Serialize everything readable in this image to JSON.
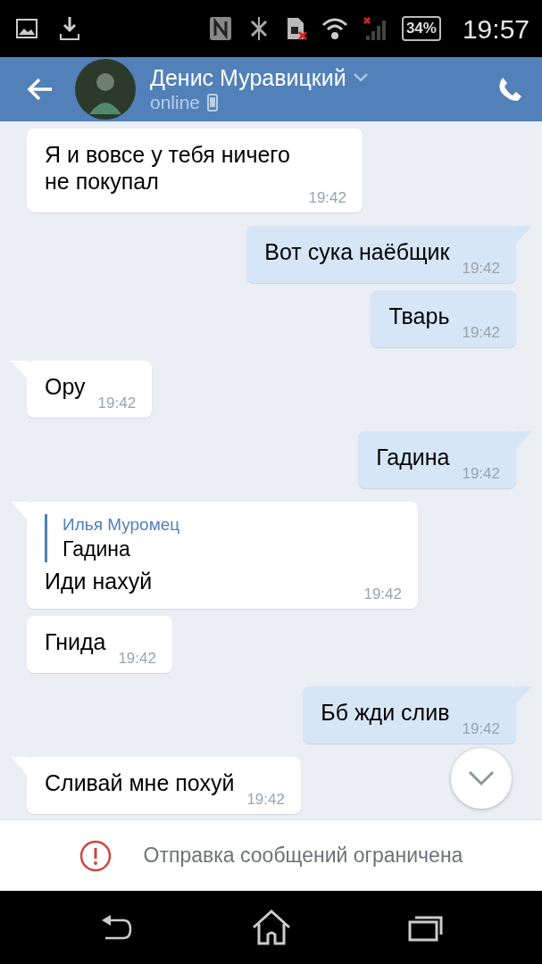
{
  "status_bar": {
    "battery": "34%",
    "time": "19:57"
  },
  "header": {
    "name": "Денис Муравицкий",
    "status": "online"
  },
  "messages": [
    {
      "outgoing": false,
      "tail": false,
      "text": "Я и вовсе у тебя ничего не покупал",
      "time": "19:42"
    },
    {
      "outgoing": true,
      "tail": true,
      "text": "Вот сука наёбщик",
      "time": "19:42"
    },
    {
      "outgoing": true,
      "tail": false,
      "text": "Тварь",
      "time": "19:42"
    },
    {
      "outgoing": false,
      "tail": true,
      "text": "Ору",
      "time": "19:42"
    },
    {
      "outgoing": true,
      "tail": true,
      "text": "Гадина",
      "time": "19:42"
    },
    {
      "outgoing": false,
      "tail": true,
      "reply": {
        "author": "Илья Муромец",
        "text": "Гадина"
      },
      "text": "Иди нахуй",
      "time": "19:42"
    },
    {
      "outgoing": false,
      "tail": false,
      "text": "Гнида",
      "time": "19:42"
    },
    {
      "outgoing": true,
      "tail": true,
      "text": "Бб жди слив",
      "time": "19:42"
    },
    {
      "outgoing": false,
      "tail": true,
      "text": "Сливай мне похуй",
      "time": "19:42"
    }
  ],
  "notice": "Отправка сообщений ограничена"
}
